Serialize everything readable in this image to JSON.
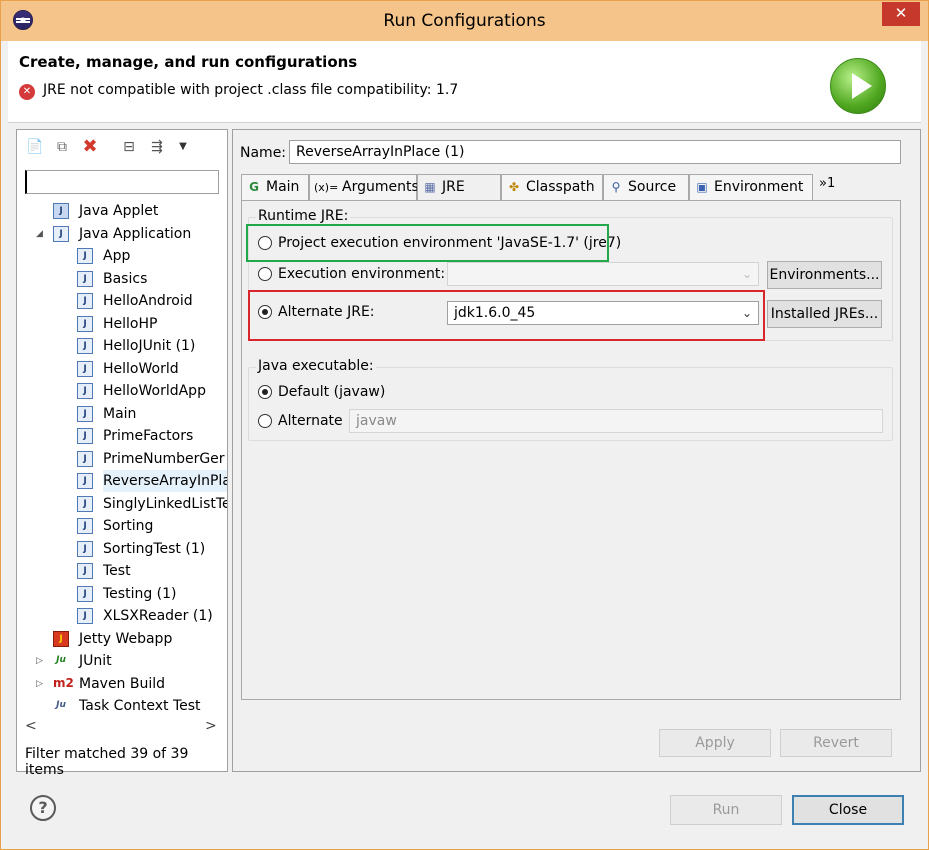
{
  "window": {
    "title": "Run Configurations",
    "close_glyph": "✕"
  },
  "header": {
    "heading": "Create, manage, and run configurations",
    "error_message": "JRE not compatible with project .class file compatibility: 1.7"
  },
  "left_panel": {
    "filter_value": "",
    "filter_status": "Filter matched 39 of 39 items",
    "tree": [
      {
        "label": "Java Applet",
        "level": 1,
        "icon": "applet-icon",
        "twisty": ""
      },
      {
        "label": "Java Application",
        "level": 1,
        "icon": "java-app-icon",
        "twisty": "◢"
      },
      {
        "label": "App",
        "level": 2,
        "icon": "java-class-icon"
      },
      {
        "label": "Basics",
        "level": 2,
        "icon": "java-class-icon"
      },
      {
        "label": "HelloAndroid",
        "level": 2,
        "icon": "java-class-icon"
      },
      {
        "label": "HelloHP",
        "level": 2,
        "icon": "java-class-icon"
      },
      {
        "label": "HelloJUnit (1)",
        "level": 2,
        "icon": "java-class-icon"
      },
      {
        "label": "HelloWorld",
        "level": 2,
        "icon": "java-class-icon"
      },
      {
        "label": "HelloWorldApp",
        "level": 2,
        "icon": "java-class-icon"
      },
      {
        "label": "Main",
        "level": 2,
        "icon": "java-class-icon"
      },
      {
        "label": "PrimeFactors",
        "level": 2,
        "icon": "java-class-icon"
      },
      {
        "label": "PrimeNumberGer",
        "level": 2,
        "icon": "java-class-icon"
      },
      {
        "label": "ReverseArrayInPla",
        "level": 2,
        "icon": "java-class-icon",
        "selected": true
      },
      {
        "label": "SinglyLinkedListTe",
        "level": 2,
        "icon": "java-class-icon"
      },
      {
        "label": "Sorting",
        "level": 2,
        "icon": "java-class-icon"
      },
      {
        "label": "SortingTest (1)",
        "level": 2,
        "icon": "java-class-icon"
      },
      {
        "label": "Test",
        "level": 2,
        "icon": "java-class-icon"
      },
      {
        "label": "Testing (1)",
        "level": 2,
        "icon": "java-class-icon"
      },
      {
        "label": "XLSXReader (1)",
        "level": 2,
        "icon": "java-class-icon"
      },
      {
        "label": "Jetty Webapp",
        "level": 1,
        "icon": "jetty-icon",
        "twisty": ""
      },
      {
        "label": "JUnit",
        "level": 1,
        "icon": "junit-icon",
        "twisty": "▷"
      },
      {
        "label": "Maven Build",
        "level": 1,
        "icon": "maven-icon",
        "twisty": "▷"
      },
      {
        "label": "Task Context Test",
        "level": 1,
        "icon": "task-context-icon",
        "twisty": ""
      }
    ]
  },
  "right_panel": {
    "name_label": "Name:",
    "name_value": "ReverseArrayInPlace (1)",
    "tabs": [
      {
        "label": "Main",
        "icon": "main-tab-icon",
        "glyph": "G"
      },
      {
        "label": "Arguments",
        "icon": "arguments-tab-icon",
        "glyph": "(x)="
      },
      {
        "label": "JRE",
        "icon": "jre-tab-icon",
        "glyph": "▦",
        "active": true
      },
      {
        "label": "Classpath",
        "icon": "classpath-tab-icon",
        "glyph": "✤"
      },
      {
        "label": "Source",
        "icon": "source-tab-icon",
        "glyph": "⚲"
      },
      {
        "label": "Environment",
        "icon": "environment-tab-icon",
        "glyph": "▣"
      }
    ],
    "tabs_overflow": "»1",
    "runtime_jre": {
      "title": "Runtime JRE:",
      "project_env_label": "Project execution environment 'JavaSE-1.7' (jre7)",
      "exec_env_label": "Execution environment:",
      "exec_env_value": "",
      "environments_button": "Environments...",
      "alternate_label": "Alternate JRE:",
      "alternate_value": "jdk1.6.0_45",
      "installed_jres_button": "Installed JREs..."
    },
    "java_executable": {
      "title": "Java executable:",
      "default_label": "Default (javaw)",
      "alternate_label": "Alternate",
      "alternate_value": "javaw"
    },
    "apply_button": "Apply",
    "revert_button": "Revert"
  },
  "footer": {
    "run_button": "Run",
    "close_button": "Close",
    "help_glyph": "?"
  },
  "colors": {
    "titlebar": "#f5c48a",
    "highlight_green": "#22a84a",
    "highlight_red": "#d9262c"
  }
}
